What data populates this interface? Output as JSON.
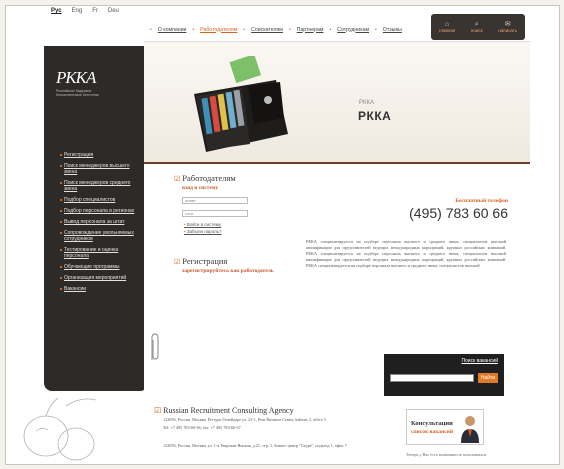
{
  "lang": [
    "Рус",
    "Eng",
    "Fr",
    "Deu"
  ],
  "topnav": [
    {
      "label": "О компании",
      "active": false
    },
    {
      "label": "Работодателям",
      "active": true
    },
    {
      "label": "Соискателям",
      "active": false
    },
    {
      "label": "Партнерам",
      "active": false
    },
    {
      "label": "Сотрудникам",
      "active": false
    },
    {
      "label": "Отзывы",
      "active": false
    }
  ],
  "toolbox": [
    {
      "icon": "home-icon",
      "glyph": "⌂",
      "label": "главная"
    },
    {
      "icon": "search-icon",
      "glyph": "⌕",
      "label": "поиск"
    },
    {
      "icon": "mail-icon",
      "glyph": "✉",
      "label": "написать"
    }
  ],
  "logo": {
    "mark": "РККА",
    "tagline": "Российское Кадровое Консалтинговое Агентство"
  },
  "sidebar": {
    "items": [
      "Регистрация",
      "Поиск менеджеров высшего звена",
      "Поиск менеджеров среднего звена",
      "Подбор специалистов",
      "Подбор персонала в регионах",
      "Вывод персонала за штат",
      "Сопровождение увольняемых сотрудников",
      "Тестирование и оценка персонала",
      "Обучающие программы",
      "Организация мероприятий",
      "Вакансии"
    ]
  },
  "hero": {
    "small": "РККА",
    "title": "РККА"
  },
  "employers": {
    "title": "Работодателям",
    "subtitle": "вход в систему",
    "login_placeholder": "логин",
    "password_placeholder": "••••••",
    "links": [
      "Войти в систему",
      "Забыли пароль?"
    ]
  },
  "registration": {
    "title": "Регистрация",
    "subtitle": "зарегистрируйтесь как работодатель"
  },
  "contact": {
    "label": "Бесплатный телефон",
    "phone": "(495) 783 60 66"
  },
  "about": "РККА специализируется на подборе персонала высшего и среднего звена, специалистов высокой квалификации для представителей ведущих международных корпораций, крупных российских компаний. РККА специализируется на подборе персонала высшего и среднего звена, специалистов высокой квалификации для представителей ведущих международных корпораций, крупных российских компаний. РККА специализируется на подборе персонала высшего и среднего звена, специалистов высокой",
  "search": {
    "label": "Поиск вакансий",
    "placeholder": "",
    "button": "Найти"
  },
  "agency": {
    "name": "Russian Recruitment Consulting Agency",
    "address1": "123056, Россия, Москва, Регтуре Гемейдере ул. 23-1, Реш Business Center, kabinet 2, office 5",
    "phone1": "Tel: +7 495 783-60-66, fax: +7 495 783-60-67",
    "address2": "123056, Россия, Москва, ул. 1-я Тверская-Ямская, д.21, стр. 1, бизнес-центр \"Скуре\", подъезд 1, офис 7"
  },
  "consult": {
    "line1": "Консультации",
    "line2": "список вакансий"
  },
  "tail": "Теперь у Вас есть возможность пользоваться"
}
